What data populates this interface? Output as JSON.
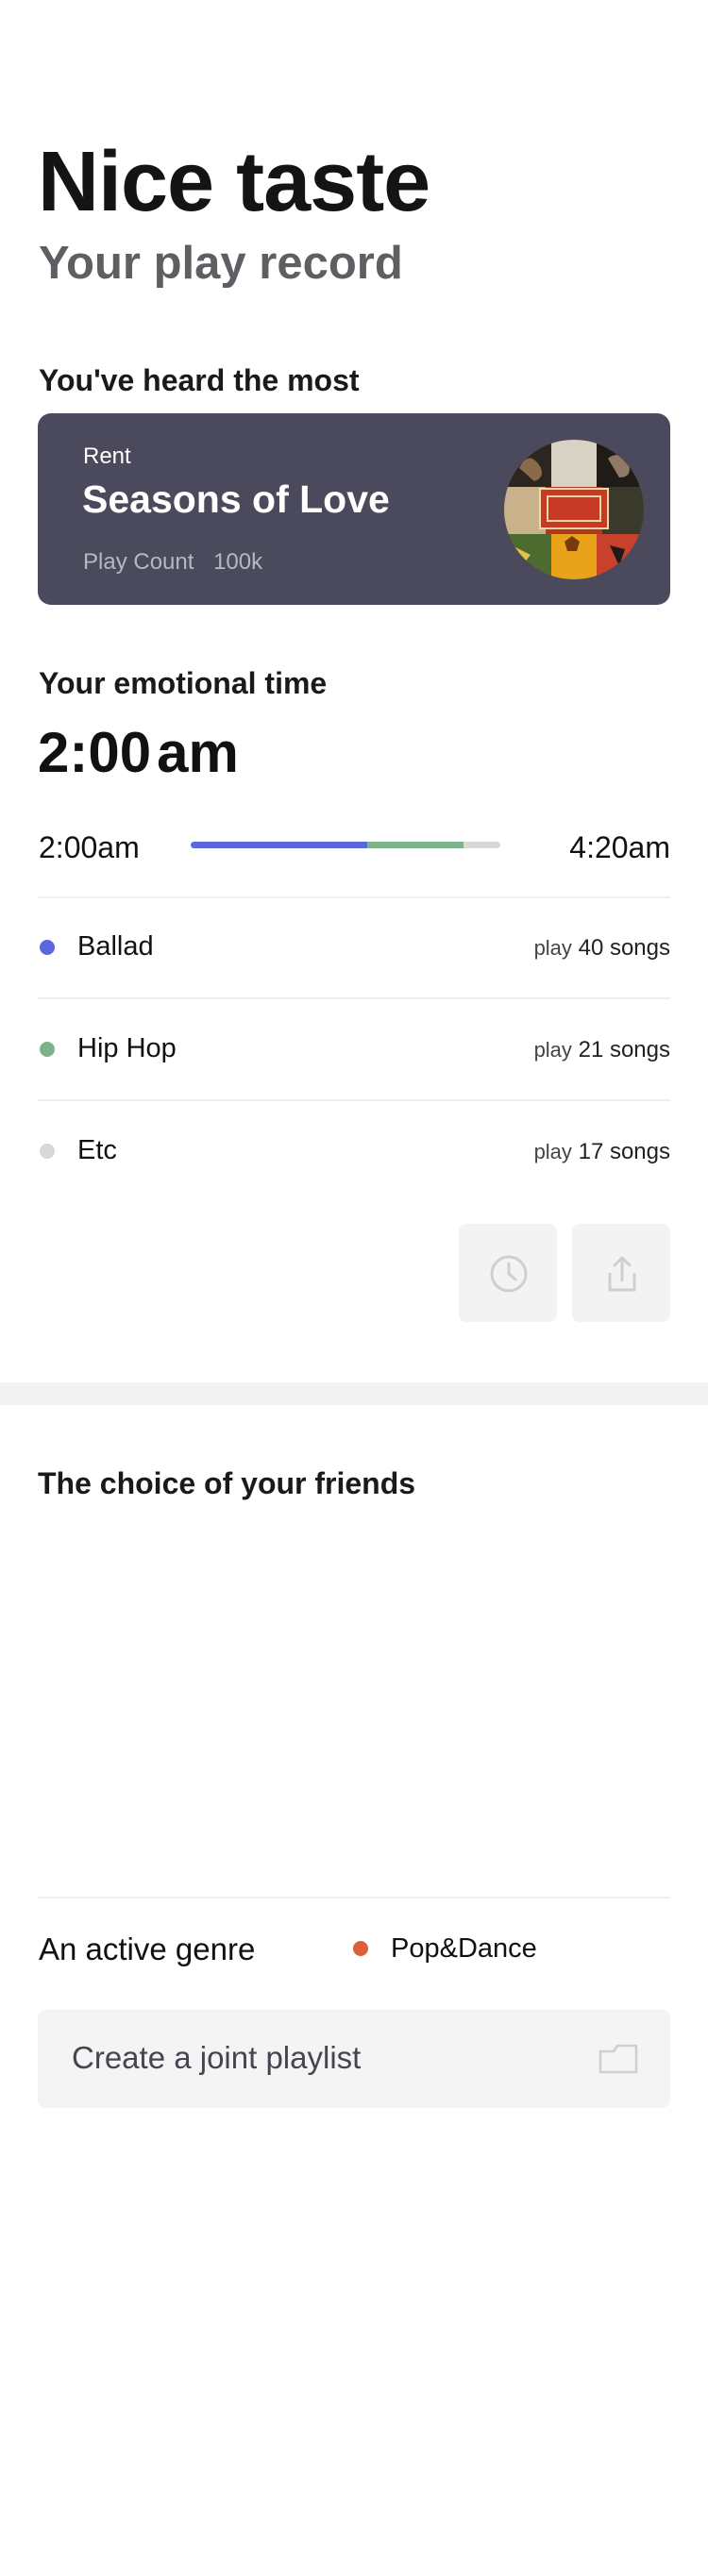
{
  "header": {
    "title": "Nice taste",
    "subtitle": "Your play record"
  },
  "most_heard": {
    "section_title": "You've heard the most",
    "artist": "Rent",
    "song": "Seasons of Love",
    "play_count_label": "Play Count",
    "play_count_value": "100k",
    "card_color": "#4a4a5c"
  },
  "emotional_time": {
    "section_title": "Your emotional time",
    "time_value": "2:00",
    "time_suffix": "am",
    "range_start": "2:00am",
    "range_end": "4:20am",
    "bar_fractions": [
      0.57,
      0.31,
      0.12
    ],
    "genres": [
      {
        "name": "Ballad",
        "play_label": "play",
        "count": "40 songs",
        "color": "#5b67dc"
      },
      {
        "name": "Hip Hop",
        "play_label": "play",
        "count": "21 songs",
        "color": "#7db38a"
      },
      {
        "name": "Etc",
        "play_label": "play",
        "count": "17 songs",
        "color": "#d8d8d8"
      }
    ],
    "actions": [
      "clock-icon",
      "share-icon"
    ]
  },
  "friends": {
    "section_title": "The choice of your friends",
    "active_genre_label": "An active genre",
    "active_genre": "Pop&Dance",
    "active_genre_color": "#d9603b",
    "joint_playlist_label": "Create a joint playlist",
    "joint_playlist_icon": "folder-icon"
  }
}
